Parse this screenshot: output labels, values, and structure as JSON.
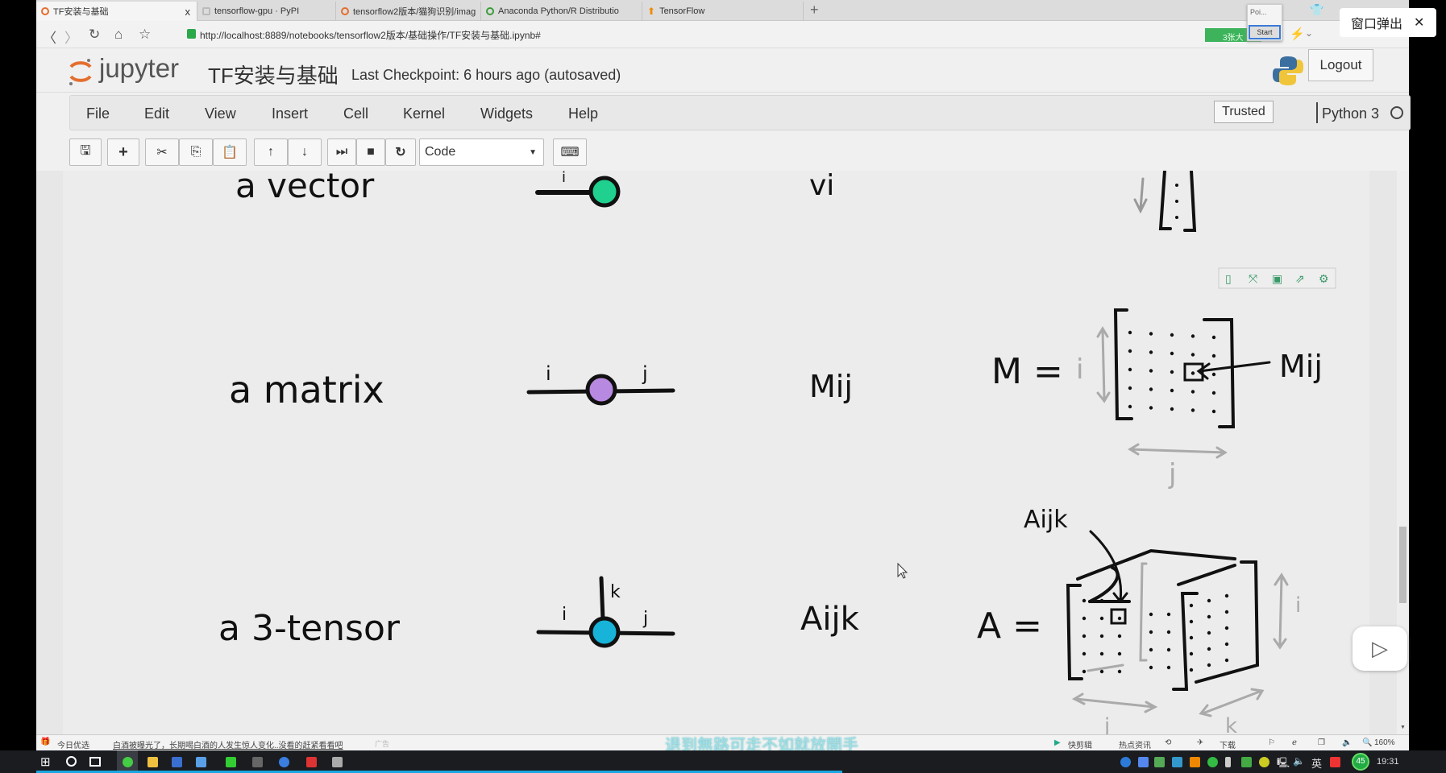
{
  "browser": {
    "tabs": [
      {
        "label": "TF安装与基础",
        "active": true
      },
      {
        "label": "tensorflow-gpu · PyPI"
      },
      {
        "label": "tensorflow2版本/猫狗识别/imag"
      },
      {
        "label": "Anaconda Python/R Distributio"
      },
      {
        "label": "TensorFlow"
      }
    ],
    "tab_close": "x",
    "new_tab": "+",
    "url": "http://localhost:8889/notebooks/tensorflow2版本/基础操作/TF安装与基础.ipynb#",
    "ext_badge": "3张大",
    "popup_title": "Poi...",
    "popup_start": "Start",
    "window_popup": "窗口弹出",
    "window_popup_close": "✕"
  },
  "jupyter": {
    "logo_text": "jupyter",
    "notebook_title": "TF安装与基础",
    "checkpoint": "Last Checkpoint: 6 hours ago (autosaved)",
    "logout": "Logout",
    "menu": [
      "File",
      "Edit",
      "View",
      "Insert",
      "Cell",
      "Kernel",
      "Widgets",
      "Help"
    ],
    "trusted": "Trusted",
    "kernel": "Python 3",
    "cell_type": "Code"
  },
  "figure": {
    "rows": [
      {
        "name": "a vector",
        "index_label": "i",
        "symbol": "vi",
        "node_color": "#1fd08f"
      },
      {
        "name": "a matrix",
        "index_labels": [
          "i",
          "j"
        ],
        "symbol": "Mij",
        "node_color": "#b889e0"
      },
      {
        "name": "a 3-tensor",
        "index_labels": [
          "i",
          "k",
          "j"
        ],
        "symbol": "Aijk",
        "node_color": "#18b3d8"
      }
    ],
    "matrix_eq": "M =",
    "matrix_i": "i",
    "matrix_j": "j",
    "matrix_elem": "Mij",
    "tensor_eq": "A =",
    "tensor_elem": "Aijk",
    "tensor_i": "i",
    "tensor_j": "j",
    "tensor_k": "k"
  },
  "statusbar": {
    "left_label": "今日优选",
    "news": "白酒被曝光了，长期喝白酒的人发生惊人变化..没看的赶紧看看吧",
    "ad": "广告",
    "subtitle": "退到無路可走不如就放開手",
    "right": [
      "快剪辑",
      "热点资讯",
      "下载"
    ],
    "zoom": "160%"
  },
  "taskbar": {
    "ime": "英",
    "badge": "45",
    "time": "19:31"
  }
}
